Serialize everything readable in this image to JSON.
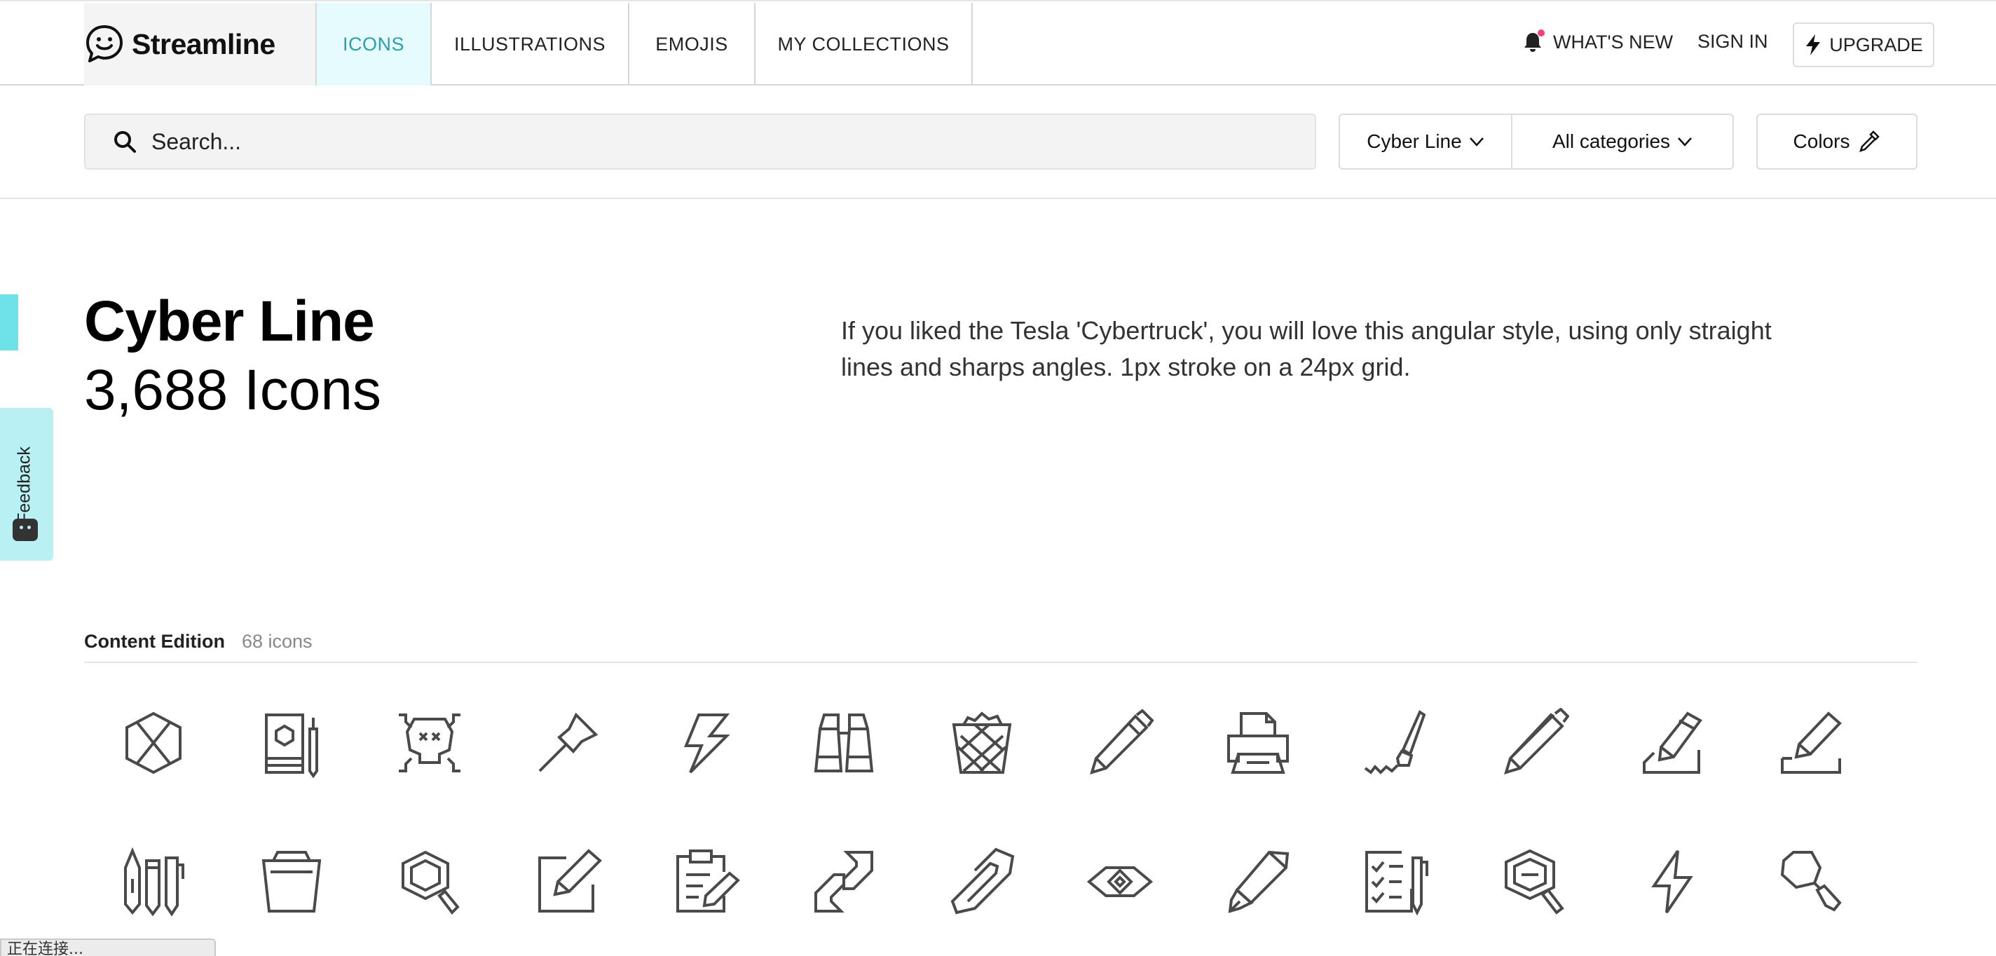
{
  "brand": {
    "name": "Streamline"
  },
  "nav": {
    "tabs": [
      {
        "label": "ICONS",
        "active": true
      },
      {
        "label": "ILLUSTRATIONS",
        "active": false
      },
      {
        "label": "EMOJIS",
        "active": false
      },
      {
        "label": "MY COLLECTIONS",
        "active": false
      }
    ],
    "whats_new": "WHAT'S NEW",
    "sign_in": "SIGN IN",
    "upgrade": "UPGRADE"
  },
  "search": {
    "placeholder": "Search...",
    "style_filter": "Cyber Line",
    "category_filter": "All categories",
    "colors_button": "Colors"
  },
  "hero": {
    "title": "Cyber Line",
    "count": "3,688 Icons",
    "description": "If you liked the Tesla 'Cybertruck', you will love this angular style, using only straight lines and sharps angles. 1px stroke on a 24px grid."
  },
  "feedback": {
    "label": "Feedback"
  },
  "section": {
    "name": "Content Edition",
    "count": "68 icons",
    "icons_row1": [
      "hexagon-cube-icon",
      "book-pencil-icon",
      "skull-crossbones-icon",
      "push-pin-icon",
      "lightning-bolt-icon",
      "binoculars-icon",
      "wastebasket-icon",
      "pencil-icon",
      "printer-icon",
      "paint-brush-icon",
      "pen-icon",
      "pencil-write-box-icon",
      "pencil-write-line-icon"
    ],
    "icons_row2": [
      "pens-set-icon",
      "bin-icon",
      "search-hexagon-icon",
      "edit-square-icon",
      "clipboard-edit-icon",
      "link-icon",
      "paperclip-icon",
      "eye-icon",
      "fountain-pen-icon",
      "checklist-pen-icon",
      "magnifier-minus-icon",
      "flash-icon",
      "search-polygon-icon"
    ]
  },
  "status": {
    "text": "正在连接..."
  },
  "colors": {
    "accent": "#2a9fb0",
    "accent_bg": "#e6fbfd",
    "feedback_bg": "#b9f0f3",
    "notification": "#f0417a"
  }
}
